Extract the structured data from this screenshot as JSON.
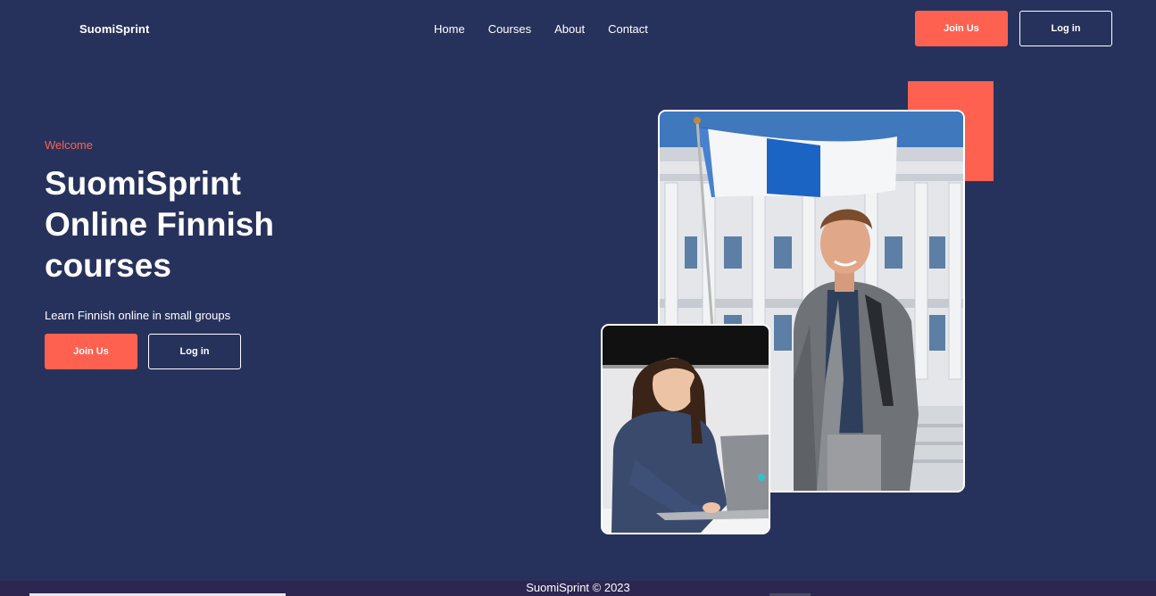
{
  "brand": "SuomiSprint",
  "nav": {
    "links": [
      "Home",
      "Courses",
      "About",
      "Contact"
    ],
    "join_label": "Join Us",
    "login_label": "Log in"
  },
  "hero": {
    "kicker": "Welcome",
    "title": "SuomiSprint Online Finnish courses",
    "subtitle": "Learn Finnish online in small groups",
    "join_label": "Join Us",
    "login_label": "Log in"
  },
  "footer": {
    "text": "SuomiSprint © 2023"
  },
  "colors": {
    "background": "#27325c",
    "accent": "#ff6150",
    "footer": "#2d2650"
  }
}
